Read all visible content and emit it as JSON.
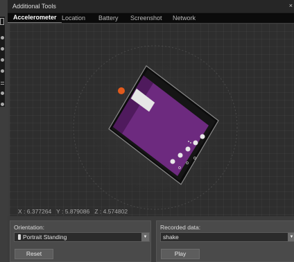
{
  "window": {
    "title": "Additional Tools",
    "close_glyph": "×"
  },
  "tabs": [
    {
      "label": "Accelerometer",
      "active": true
    },
    {
      "label": "Location",
      "active": false
    },
    {
      "label": "Battery",
      "active": false
    },
    {
      "label": "Screenshot",
      "active": false
    },
    {
      "label": "Network",
      "active": false
    }
  ],
  "readout": {
    "x": "X : 6.377264",
    "y": "Y : 5.879086",
    "z": "Z : 4.574802"
  },
  "orientation": {
    "label": "Orientation:",
    "value": "Portrait Standing",
    "reset_label": "Reset"
  },
  "recorded": {
    "label": "Recorded data:",
    "value": "shake",
    "play_label": "Play"
  },
  "colors": {
    "screen_purple": "#6d2a7f",
    "status_bar": "#4f1a5d",
    "handle_orange": "#e25a1c",
    "device_body": "#141414"
  },
  "icons": {
    "dropdown": "chevron-down-icon",
    "portrait": "phone-icon",
    "rotate_handle": "rotation-handle-icon"
  }
}
